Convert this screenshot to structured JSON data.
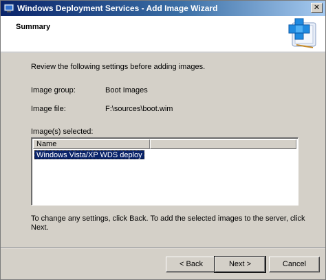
{
  "window": {
    "title": "Windows Deployment Services - Add Image Wizard",
    "close_glyph": "✕"
  },
  "header": {
    "heading": "Summary",
    "icon": "add-image-wizard-icon"
  },
  "content": {
    "intro": "Review the following settings before adding images.",
    "image_group_label": "Image group:",
    "image_group_value": "Boot Images",
    "image_file_label": "Image file:",
    "image_file_value": "F:\\sources\\boot.wim",
    "images_selected_label": "Image(s) selected:",
    "list": {
      "columns": [
        "Name",
        ""
      ],
      "rows": [
        "Windows Vista/XP WDS deploy"
      ]
    },
    "footer_text": "To change any settings, click Back. To add the selected images to the server, click Next."
  },
  "buttons": {
    "back": "< Back",
    "next": "Next >",
    "cancel": "Cancel"
  },
  "colors": {
    "selection": "#0a246a",
    "dialog_face": "#d4d0c8"
  }
}
